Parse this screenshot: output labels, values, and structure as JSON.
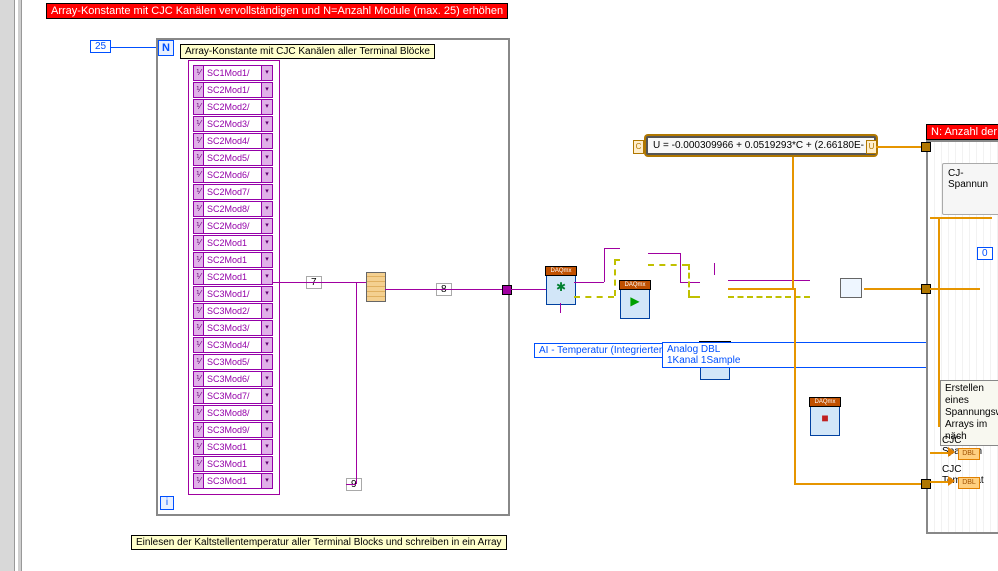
{
  "banner_top": "Array-Konstante mit CJC Kanälen vervollständigen und N=Anzahl Module (max. 25) erhöhen",
  "n_value": "25",
  "n_label": "N",
  "array_label": "Array-Konstante mit CJC Kanälen aller Terminal Blöcke",
  "channels": [
    "SC1Mod1/",
    "SC2Mod1/",
    "SC2Mod2/",
    "SC2Mod3/",
    "SC2Mod4/",
    "SC2Mod5/",
    "SC2Mod6/",
    "SC2Mod7/",
    "SC2Mod8/",
    "SC2Mod9/",
    "SC2Mod1",
    "SC2Mod1",
    "SC2Mod1",
    "SC3Mod1/",
    "SC3Mod2/",
    "SC3Mod3/",
    "SC3Mod4/",
    "SC3Mod5/",
    "SC3Mod6/",
    "SC3Mod7/",
    "SC3Mod8/",
    "SC3Mod9/",
    "SC3Mod1",
    "SC3Mod1",
    "SC3Mod1"
  ],
  "wire_7": "7",
  "wire_8": "8",
  "wire_9": "9",
  "i_label": "i",
  "bottom_comment": "Einlesen der Kaltstellentemperatur aller Terminal Blocks und schreiben in ein Array",
  "expr": "U = -0.000309966 + 0.0519293*C + (2.66180E-",
  "expr_C": "C",
  "expr_U": "U",
  "daq_hdr": "DAQmx",
  "ai_ring": "AI - Temperatur (Integrierter Sensor)",
  "read_ring_l1": "Analog DBL",
  "read_ring_l2": "1Kanal 1Sample",
  "right_banner": "N: Anzahl der",
  "right_label": "CJ-Spannun",
  "right_zero": "0",
  "right_comment_l1": "Erstellen eines",
  "right_comment_l2": "Spannungswer",
  "right_comment_l3": "Arrays im näch",
  "indic1": "CJC Spannun",
  "indic2": "CJC Temperat",
  "dbl": "DBL"
}
